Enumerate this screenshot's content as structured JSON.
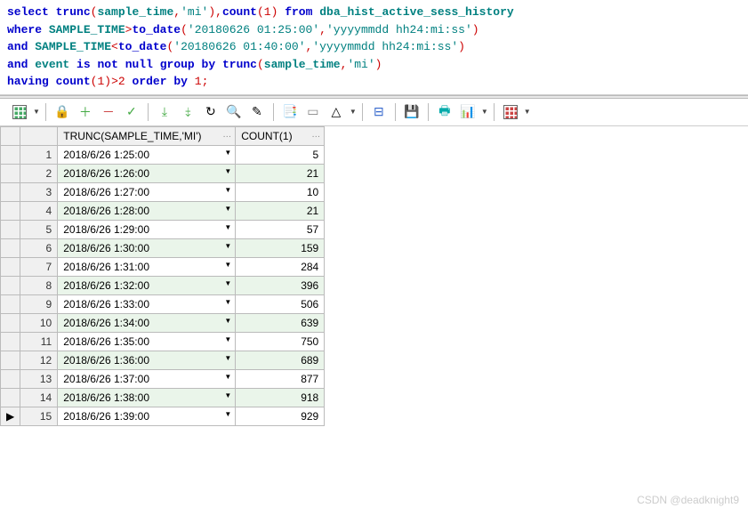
{
  "sql": {
    "tokens": [
      {
        "t": "kw",
        "v": "select"
      },
      {
        "t": "sp",
        "v": " "
      },
      {
        "t": "fn",
        "v": "trunc"
      },
      {
        "t": "punc",
        "v": "("
      },
      {
        "t": "ident",
        "v": "sample_time"
      },
      {
        "t": "punc",
        "v": ","
      },
      {
        "t": "str",
        "v": "'mi'"
      },
      {
        "t": "punc",
        "v": ")"
      },
      {
        "t": "punc",
        "v": ","
      },
      {
        "t": "fn",
        "v": "count"
      },
      {
        "t": "punc",
        "v": "("
      },
      {
        "t": "num",
        "v": "1"
      },
      {
        "t": "punc",
        "v": ")"
      },
      {
        "t": "sp",
        "v": " "
      },
      {
        "t": "kw",
        "v": "from"
      },
      {
        "t": "sp",
        "v": " "
      },
      {
        "t": "ident",
        "v": "dba_hist_active_sess_history"
      },
      {
        "t": "nl"
      },
      {
        "t": "kw",
        "v": "where"
      },
      {
        "t": "sp",
        "v": " "
      },
      {
        "t": "ident",
        "v": "SAMPLE_TIME"
      },
      {
        "t": "op",
        "v": ">"
      },
      {
        "t": "fn",
        "v": "to_date"
      },
      {
        "t": "punc",
        "v": "("
      },
      {
        "t": "str",
        "v": "'20180626 01:25:00'"
      },
      {
        "t": "punc",
        "v": ","
      },
      {
        "t": "str",
        "v": "'yyyymmdd hh24:mi:ss'"
      },
      {
        "t": "punc",
        "v": ")"
      },
      {
        "t": "nl"
      },
      {
        "t": "kw",
        "v": "and"
      },
      {
        "t": "sp",
        "v": " "
      },
      {
        "t": "ident",
        "v": "SAMPLE_TIME"
      },
      {
        "t": "op",
        "v": "<"
      },
      {
        "t": "fn",
        "v": "to_date"
      },
      {
        "t": "punc",
        "v": "("
      },
      {
        "t": "str",
        "v": "'20180626 01:40:00'"
      },
      {
        "t": "punc",
        "v": ","
      },
      {
        "t": "str",
        "v": "'yyyymmdd hh24:mi:ss'"
      },
      {
        "t": "punc",
        "v": ")"
      },
      {
        "t": "nl"
      },
      {
        "t": "kw",
        "v": "and"
      },
      {
        "t": "sp",
        "v": " "
      },
      {
        "t": "ident",
        "v": "event"
      },
      {
        "t": "sp",
        "v": " "
      },
      {
        "t": "kw",
        "v": "is"
      },
      {
        "t": "sp",
        "v": " "
      },
      {
        "t": "kw",
        "v": "not"
      },
      {
        "t": "sp",
        "v": " "
      },
      {
        "t": "kw",
        "v": "null"
      },
      {
        "t": "sp",
        "v": " "
      },
      {
        "t": "kw",
        "v": "group"
      },
      {
        "t": "sp",
        "v": " "
      },
      {
        "t": "kw",
        "v": "by"
      },
      {
        "t": "sp",
        "v": " "
      },
      {
        "t": "fn",
        "v": "trunc"
      },
      {
        "t": "punc",
        "v": "("
      },
      {
        "t": "ident",
        "v": "sample_time"
      },
      {
        "t": "punc",
        "v": ","
      },
      {
        "t": "str",
        "v": "'mi'"
      },
      {
        "t": "punc",
        "v": ")"
      },
      {
        "t": "nl"
      },
      {
        "t": "kw",
        "v": "having"
      },
      {
        "t": "sp",
        "v": " "
      },
      {
        "t": "fn",
        "v": "count"
      },
      {
        "t": "punc",
        "v": "("
      },
      {
        "t": "num",
        "v": "1"
      },
      {
        "t": "punc",
        "v": ")"
      },
      {
        "t": "op",
        "v": ">"
      },
      {
        "t": "num",
        "v": "2"
      },
      {
        "t": "sp",
        "v": " "
      },
      {
        "t": "kw",
        "v": "order"
      },
      {
        "t": "sp",
        "v": " "
      },
      {
        "t": "kw",
        "v": "by"
      },
      {
        "t": "sp",
        "v": " "
      },
      {
        "t": "num",
        "v": "1"
      },
      {
        "t": "punc",
        "v": ";"
      }
    ]
  },
  "toolbar": {
    "buttons": [
      {
        "name": "grid-icon",
        "glyph": "grid",
        "dd": true
      },
      {
        "name": "sep"
      },
      {
        "name": "lock-icon",
        "glyph": "🔒"
      },
      {
        "name": "add-icon",
        "glyph": "＋",
        "color": "#4a4"
      },
      {
        "name": "remove-icon",
        "glyph": "－",
        "color": "#c44"
      },
      {
        "name": "commit-icon",
        "glyph": "✓",
        "color": "#4a4"
      },
      {
        "name": "sep"
      },
      {
        "name": "fetch-icon",
        "glyph": "⤓",
        "color": "#4a4"
      },
      {
        "name": "fetch-all-icon",
        "glyph": "⤈",
        "color": "#4a4"
      },
      {
        "name": "refresh-icon",
        "glyph": "↻"
      },
      {
        "name": "find-icon",
        "glyph": "🔍"
      },
      {
        "name": "eraser-icon",
        "glyph": "✎"
      },
      {
        "name": "sep"
      },
      {
        "name": "bookmarks-icon",
        "glyph": "📑"
      },
      {
        "name": "goto-icon",
        "glyph": "▭",
        "color": "#888"
      },
      {
        "name": "nav-icon",
        "glyph": "△",
        "dd": true
      },
      {
        "name": "sep"
      },
      {
        "name": "single-record-icon",
        "glyph": "⊟",
        "color": "#36c"
      },
      {
        "name": "sep"
      },
      {
        "name": "save-icon",
        "glyph": "💾"
      },
      {
        "name": "sep"
      },
      {
        "name": "print-icon",
        "glyph": "🖶",
        "color": "#0aa"
      },
      {
        "name": "chart-icon",
        "glyph": "📊",
        "dd": true
      },
      {
        "name": "sep"
      },
      {
        "name": "grid-options-icon",
        "glyph": "grid2",
        "dd": true
      }
    ]
  },
  "results": {
    "columns": [
      "TRUNC(SAMPLE_TIME,'MI')",
      "COUNT(1)"
    ],
    "rows": [
      {
        "n": "1",
        "time": "2018/6/26 1:25:00",
        "count": "5"
      },
      {
        "n": "2",
        "time": "2018/6/26 1:26:00",
        "count": "21"
      },
      {
        "n": "3",
        "time": "2018/6/26 1:27:00",
        "count": "10"
      },
      {
        "n": "4",
        "time": "2018/6/26 1:28:00",
        "count": "21"
      },
      {
        "n": "5",
        "time": "2018/6/26 1:29:00",
        "count": "57"
      },
      {
        "n": "6",
        "time": "2018/6/26 1:30:00",
        "count": "159"
      },
      {
        "n": "7",
        "time": "2018/6/26 1:31:00",
        "count": "284"
      },
      {
        "n": "8",
        "time": "2018/6/26 1:32:00",
        "count": "396"
      },
      {
        "n": "9",
        "time": "2018/6/26 1:33:00",
        "count": "506"
      },
      {
        "n": "10",
        "time": "2018/6/26 1:34:00",
        "count": "639"
      },
      {
        "n": "11",
        "time": "2018/6/26 1:35:00",
        "count": "750"
      },
      {
        "n": "12",
        "time": "2018/6/26 1:36:00",
        "count": "689"
      },
      {
        "n": "13",
        "time": "2018/6/26 1:37:00",
        "count": "877"
      },
      {
        "n": "14",
        "time": "2018/6/26 1:38:00",
        "count": "918"
      },
      {
        "n": "15",
        "time": "2018/6/26 1:39:00",
        "count": "929"
      }
    ],
    "currentRow": 15
  },
  "watermark": "CSDN @deadknight9"
}
